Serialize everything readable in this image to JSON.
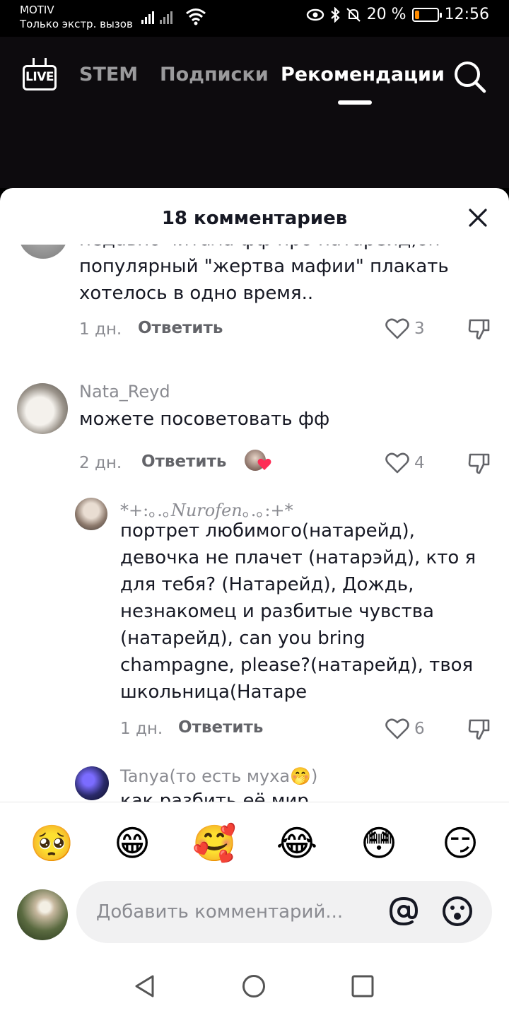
{
  "status_bar": {
    "carrier": "MOTIV",
    "emergency": "Только экстр. вызов",
    "battery": "20 %",
    "battery_level": 0.2,
    "time": "12:56"
  },
  "top_nav": {
    "live_label": "LIVE",
    "tabs": [
      {
        "label": "STEM",
        "active": false
      },
      {
        "label": "Подписки",
        "active": false
      },
      {
        "label": "Рекомендации",
        "active": true
      }
    ]
  },
  "sheet": {
    "title": "18 комментариев"
  },
  "comments": [
    {
      "text_partial": "недавно читала фф про натарейд,он",
      "text": "популярный \"жертва мафии\" плакать\nхотелось в одно время..",
      "time": "1 дн.",
      "reply": "Ответить",
      "likes": "3"
    },
    {
      "username": "Nata_Reyd",
      "text": "можете посоветовать фф",
      "time": "2 дн.",
      "reply": "Ответить",
      "likes": "4"
    },
    {
      "username": "*+:｡.｡𝑁𝑢𝑟𝑜𝑓𝑒𝑛｡.｡:+*",
      "text": "портрет любимого(натарейд),\nдевочка не плачет (натарэйд), кто я\nдля тебя? (Натарейд), Дождь,\nнезнакомец и разбитые чувства\n(натарейд), can you bring\nchampagne, please?(натарейд), твоя\nшкольница(Натаре",
      "time": "1 дн.",
      "reply": "Ответить",
      "likes": "6"
    },
    {
      "username": "Tanya(то есть муха🤭)",
      "text_partial": "как разбить её мир"
    }
  ],
  "emoji_bar": [
    "🥺",
    "😁",
    "🥰",
    "😂",
    "😳",
    "😏"
  ],
  "composer": {
    "placeholder": "Добавить комментарий..."
  },
  "colors": {
    "nav_bg": "#0d0b0e",
    "sheet_bg": "#ffffff",
    "text_primary": "#161823",
    "text_secondary": "#8a8b91"
  }
}
